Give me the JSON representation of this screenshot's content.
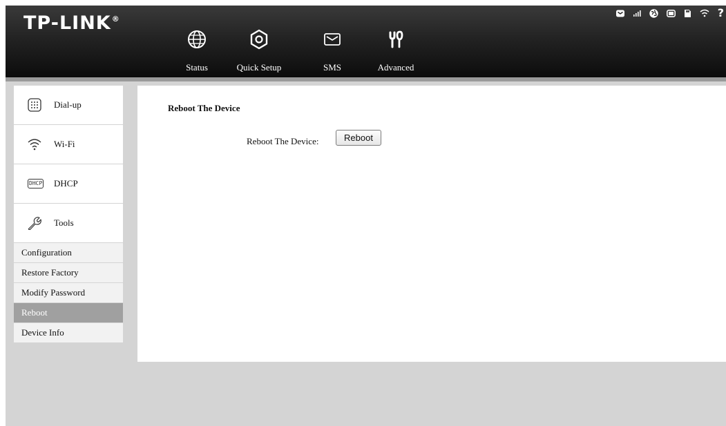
{
  "header": {
    "logo": "TP-LINK",
    "logo_mark": "®",
    "nav": [
      {
        "label": "Status",
        "icon": "globe-icon"
      },
      {
        "label": "Quick Setup",
        "icon": "gear-icon"
      },
      {
        "label": "SMS",
        "icon": "envelope-icon"
      },
      {
        "label": "Advanced",
        "icon": "tools-icon"
      }
    ],
    "status_icons": [
      "message-icon",
      "signal-icon",
      "internet-icon",
      "battery-icon",
      "sim-card-icon",
      "wifi-icon",
      "help-icon"
    ],
    "help_text": "?"
  },
  "sidebar": {
    "items": [
      {
        "label": "Dial-up",
        "icon": "dialpad-icon"
      },
      {
        "label": "Wi-Fi",
        "icon": "wifi-icon"
      },
      {
        "label": "DHCP",
        "icon": "dhcp-icon",
        "icon_text": "DHCP"
      },
      {
        "label": "Tools",
        "icon": "wrench-icon"
      }
    ],
    "tools_submenu": [
      {
        "label": "Configuration",
        "active": false
      },
      {
        "label": "Restore Factory",
        "active": false
      },
      {
        "label": "Modify Password",
        "active": false
      },
      {
        "label": "Reboot",
        "active": true
      },
      {
        "label": "Device Info",
        "active": false
      }
    ]
  },
  "main": {
    "section_title": "Reboot The Device",
    "reboot_label": "Reboot The Device:",
    "reboot_button": "Reboot"
  },
  "colors": {
    "header_dark": "#0c0c0c",
    "page_bg": "#d4d4d4",
    "active_submenu": "#a0a0a0"
  }
}
